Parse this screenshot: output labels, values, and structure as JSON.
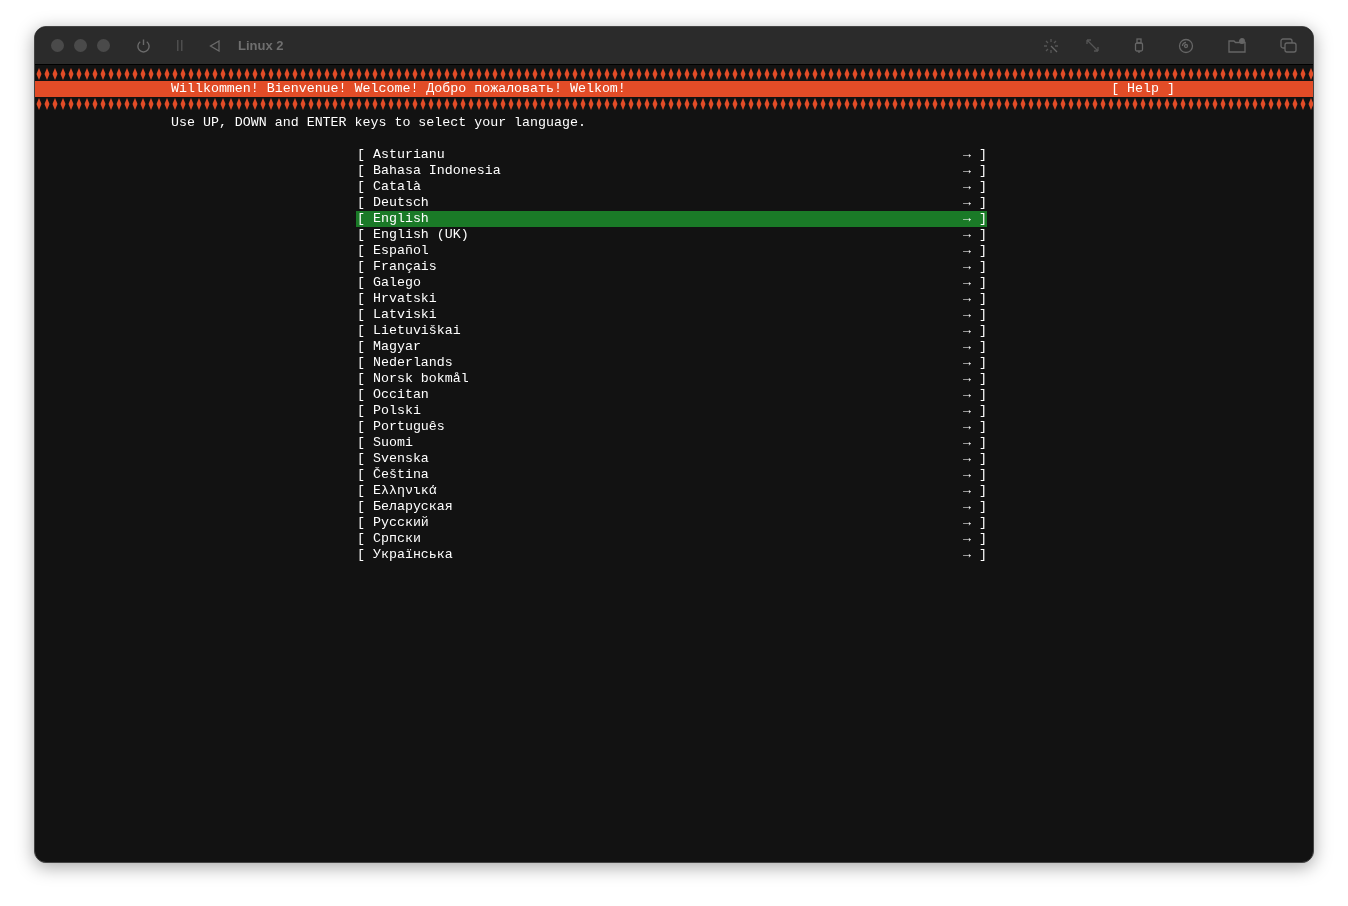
{
  "window": {
    "title": "Linux 2"
  },
  "banner": {
    "welcome": "Willkommen! Bienvenue! Welcome! Добро пожаловать! Welkom!",
    "help": "[ Help ]"
  },
  "instruction": "Use UP, DOWN and ENTER keys to select your language.",
  "languages": [
    {
      "open": "[",
      "label": "Asturianu",
      "arrow": "→",
      "close": "]",
      "selected": false
    },
    {
      "open": "[",
      "label": "Bahasa Indonesia",
      "arrow": "→",
      "close": "]",
      "selected": false
    },
    {
      "open": "[",
      "label": "Català",
      "arrow": "→",
      "close": "]",
      "selected": false
    },
    {
      "open": "[",
      "label": "Deutsch",
      "arrow": "→",
      "close": "]",
      "selected": false
    },
    {
      "open": "[",
      "label": "English",
      "arrow": "→",
      "close": "]",
      "selected": true
    },
    {
      "open": "[",
      "label": "English (UK)",
      "arrow": "→",
      "close": "]",
      "selected": false
    },
    {
      "open": "[",
      "label": "Español",
      "arrow": "→",
      "close": "]",
      "selected": false
    },
    {
      "open": "[",
      "label": "Français",
      "arrow": "→",
      "close": "]",
      "selected": false
    },
    {
      "open": "[",
      "label": "Galego",
      "arrow": "→",
      "close": "]",
      "selected": false
    },
    {
      "open": "[",
      "label": "Hrvatski",
      "arrow": "→",
      "close": "]",
      "selected": false
    },
    {
      "open": "[",
      "label": "Latviski",
      "arrow": "→",
      "close": "]",
      "selected": false
    },
    {
      "open": "[",
      "label": "Lietuviškai",
      "arrow": "→",
      "close": "]",
      "selected": false
    },
    {
      "open": "[",
      "label": "Magyar",
      "arrow": "→",
      "close": "]",
      "selected": false
    },
    {
      "open": "[",
      "label": "Nederlands",
      "arrow": "→",
      "close": "]",
      "selected": false
    },
    {
      "open": "[",
      "label": "Norsk bokmål",
      "arrow": "→",
      "close": "]",
      "selected": false
    },
    {
      "open": "[",
      "label": "Occitan",
      "arrow": "→",
      "close": "]",
      "selected": false
    },
    {
      "open": "[",
      "label": "Polski",
      "arrow": "→",
      "close": "]",
      "selected": false
    },
    {
      "open": "[",
      "label": "Português",
      "arrow": "→",
      "close": "]",
      "selected": false
    },
    {
      "open": "[",
      "label": "Suomi",
      "arrow": "→",
      "close": "]",
      "selected": false
    },
    {
      "open": "[",
      "label": "Svenska",
      "arrow": "→",
      "close": "]",
      "selected": false
    },
    {
      "open": "[",
      "label": "Čeština",
      "arrow": "→",
      "close": "]",
      "selected": false
    },
    {
      "open": "[",
      "label": "Ελληνικά",
      "arrow": "→",
      "close": "]",
      "selected": false
    },
    {
      "open": "[",
      "label": "Беларуская",
      "arrow": "→",
      "close": "]",
      "selected": false
    },
    {
      "open": "[",
      "label": "Русский",
      "arrow": "→",
      "close": "]",
      "selected": false
    },
    {
      "open": "[",
      "label": "Српски",
      "arrow": "→",
      "close": "]",
      "selected": false
    },
    {
      "open": "[",
      "label": "Українська",
      "arrow": "→",
      "close": "]",
      "selected": false
    }
  ]
}
